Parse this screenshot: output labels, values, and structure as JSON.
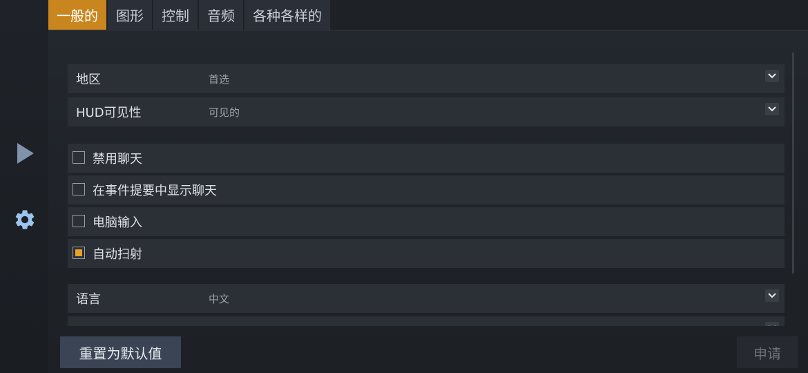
{
  "tabs": [
    {
      "label": "一般的",
      "active": true
    },
    {
      "label": "图形",
      "active": false
    },
    {
      "label": "控制",
      "active": false
    },
    {
      "label": "音频",
      "active": false
    },
    {
      "label": "各种各样的",
      "active": false
    }
  ],
  "rail": {
    "play_icon": "play-icon",
    "gear_icon": "gear-icon"
  },
  "settings": {
    "region": {
      "label": "地区",
      "value": "首选"
    },
    "hud": {
      "label": "HUD可见性",
      "value": "可见的"
    },
    "checkboxes": [
      {
        "label": "禁用聊天",
        "checked": false
      },
      {
        "label": "在事件提要中显示聊天",
        "checked": false
      },
      {
        "label": "电脑输入",
        "checked": false
      },
      {
        "label": "自动扫射",
        "checked": true
      }
    ],
    "language": {
      "label": "语言",
      "value": "中文"
    }
  },
  "footer": {
    "reset_label": "重置为默认值",
    "apply_label": "申请"
  },
  "colors": {
    "accent": "#c9861e",
    "checkbox_fill": "#e8a227"
  }
}
